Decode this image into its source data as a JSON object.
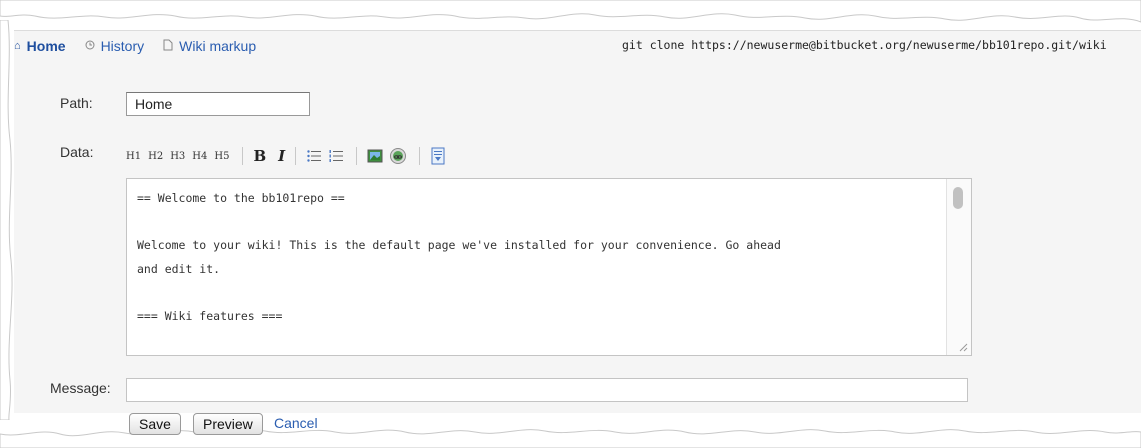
{
  "nav": {
    "items": [
      {
        "label": "Home",
        "icon": "home-icon",
        "active": true
      },
      {
        "label": "History",
        "icon": "clock-icon",
        "active": false
      },
      {
        "label": "Wiki markup",
        "icon": "document-icon",
        "active": false
      }
    ],
    "clone_command": "git clone https://newuserme@bitbucket.org/newuserme/bb101repo.git/wiki"
  },
  "form": {
    "path_label": "Path:",
    "path_value": "Home",
    "data_label": "Data:",
    "message_label": "Message:",
    "message_value": "",
    "toolbar": {
      "headings": [
        "H1",
        "H2",
        "H3",
        "H4",
        "H5"
      ],
      "bold": "B",
      "italic": "I"
    },
    "editor_content": "== Welcome to the bb101repo ==\n\nWelcome to your wiki! This is the default page we've installed for your convenience. Go ahead\nand edit it.\n\n=== Wiki features ===\n\nThis wiki uses the [[http://www.wikicreole.org/|Creole]] syntax, and is fully compatible with",
    "buttons": {
      "save": "Save",
      "preview": "Preview",
      "cancel": "Cancel"
    }
  },
  "colors": {
    "link": "#2a5db0",
    "panel_bg": "#f5f5f5"
  }
}
